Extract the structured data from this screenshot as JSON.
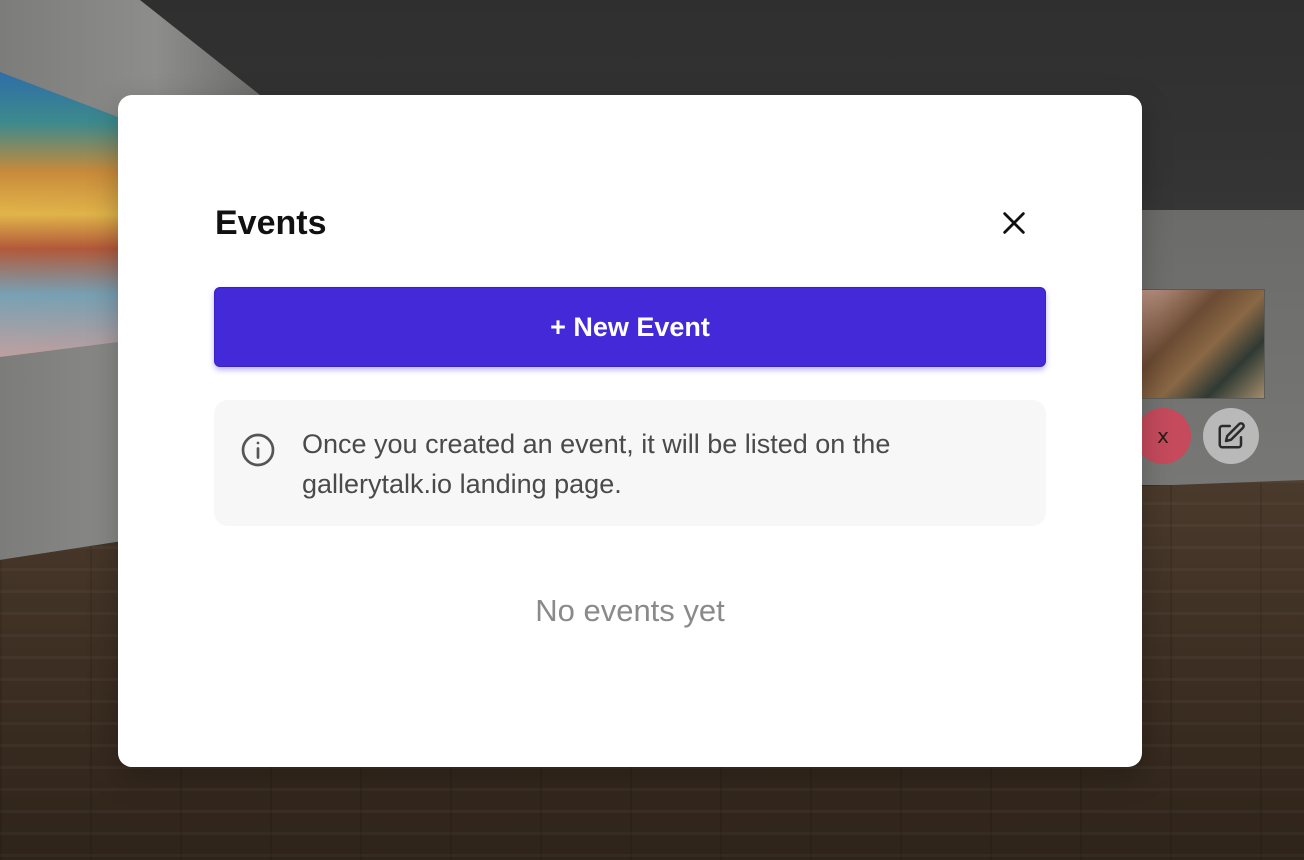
{
  "modal": {
    "title": "Events",
    "new_event_label": "+ New Event",
    "info_text": "Once you created an event, it will be listed on the gallerytalk.io landing page.",
    "empty_text": "No events yet"
  },
  "background": {
    "delete_button_label": "x"
  },
  "icons": {
    "close": "close-icon",
    "info": "info-circle-icon",
    "edit": "pencil-square-icon"
  },
  "colors": {
    "primary": "#4429d8",
    "danger": "#c54a5c",
    "surface": "#ffffff",
    "info_bg": "#f7f7f7"
  }
}
